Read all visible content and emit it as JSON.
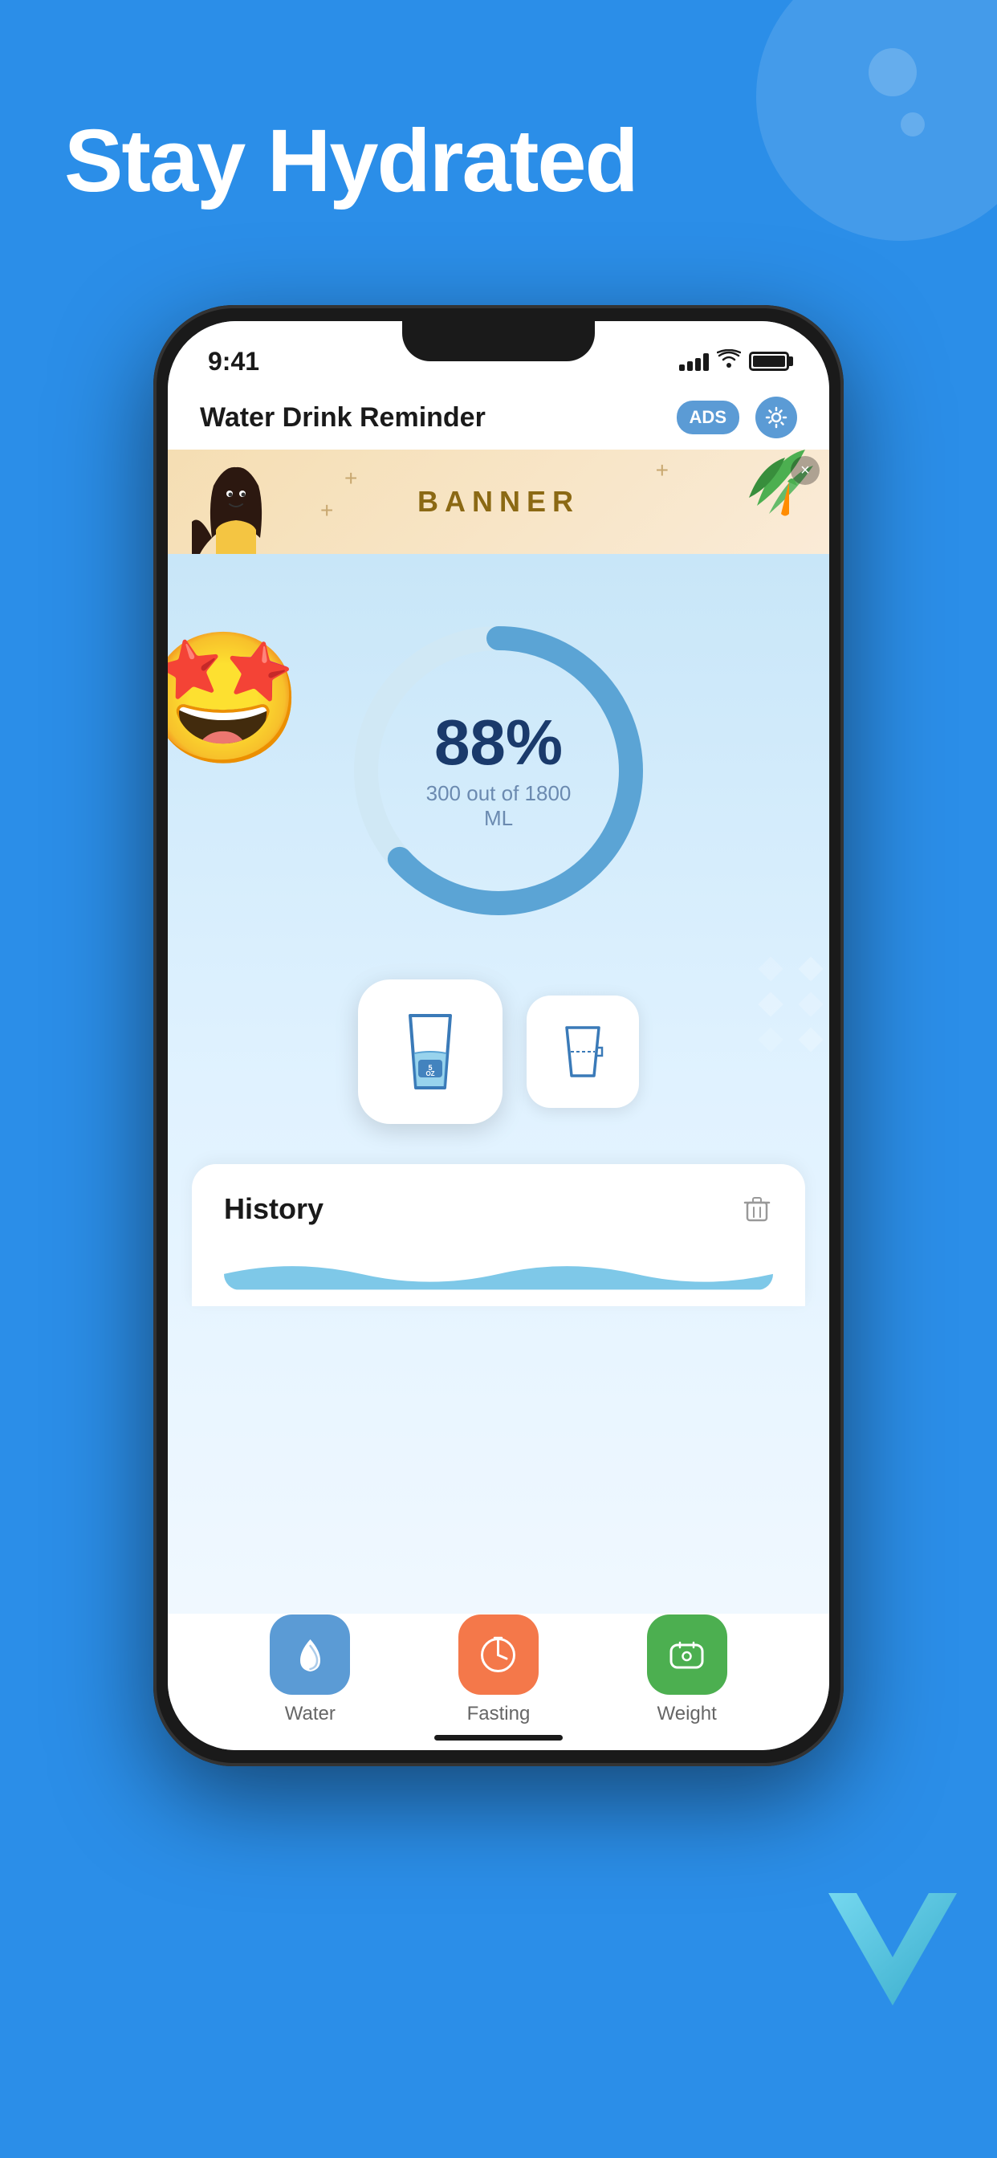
{
  "page": {
    "background_color": "#2B8EE8",
    "title": "Stay Hydrated"
  },
  "status_bar": {
    "time": "9:41",
    "signal": "4 bars",
    "wifi": true,
    "battery": "full"
  },
  "app_header": {
    "title": "Water Drink Reminder",
    "ads_label": "ADS",
    "settings_icon": "⚙"
  },
  "banner": {
    "text": "BANNER",
    "close_icon": "×"
  },
  "progress": {
    "percentage": "88%",
    "description": "300 out of 1800 ML",
    "ring_color": "#5BA4D5",
    "ring_bg_color": "#D6EAF8",
    "fill_percent": 88
  },
  "emoji": {
    "symbol": "🤩"
  },
  "drink_buttons": {
    "primary": {
      "label": "5\nOZ",
      "icon": "glass"
    },
    "secondary": {
      "icon": "custom-glass"
    }
  },
  "history": {
    "title": "History"
  },
  "bottom_nav": {
    "items": [
      {
        "id": "water",
        "label": "Water",
        "icon": "💧",
        "color": "#5B9BD5",
        "active": true
      },
      {
        "id": "fasting",
        "label": "Fasting",
        "icon": "⏰",
        "color": "#F4784A",
        "active": false
      },
      {
        "id": "weight",
        "label": "Weight",
        "icon": "💬",
        "color": "#4CAF50",
        "active": false
      }
    ]
  },
  "decorations": {
    "v_logo_color": "#4DB8D8"
  }
}
